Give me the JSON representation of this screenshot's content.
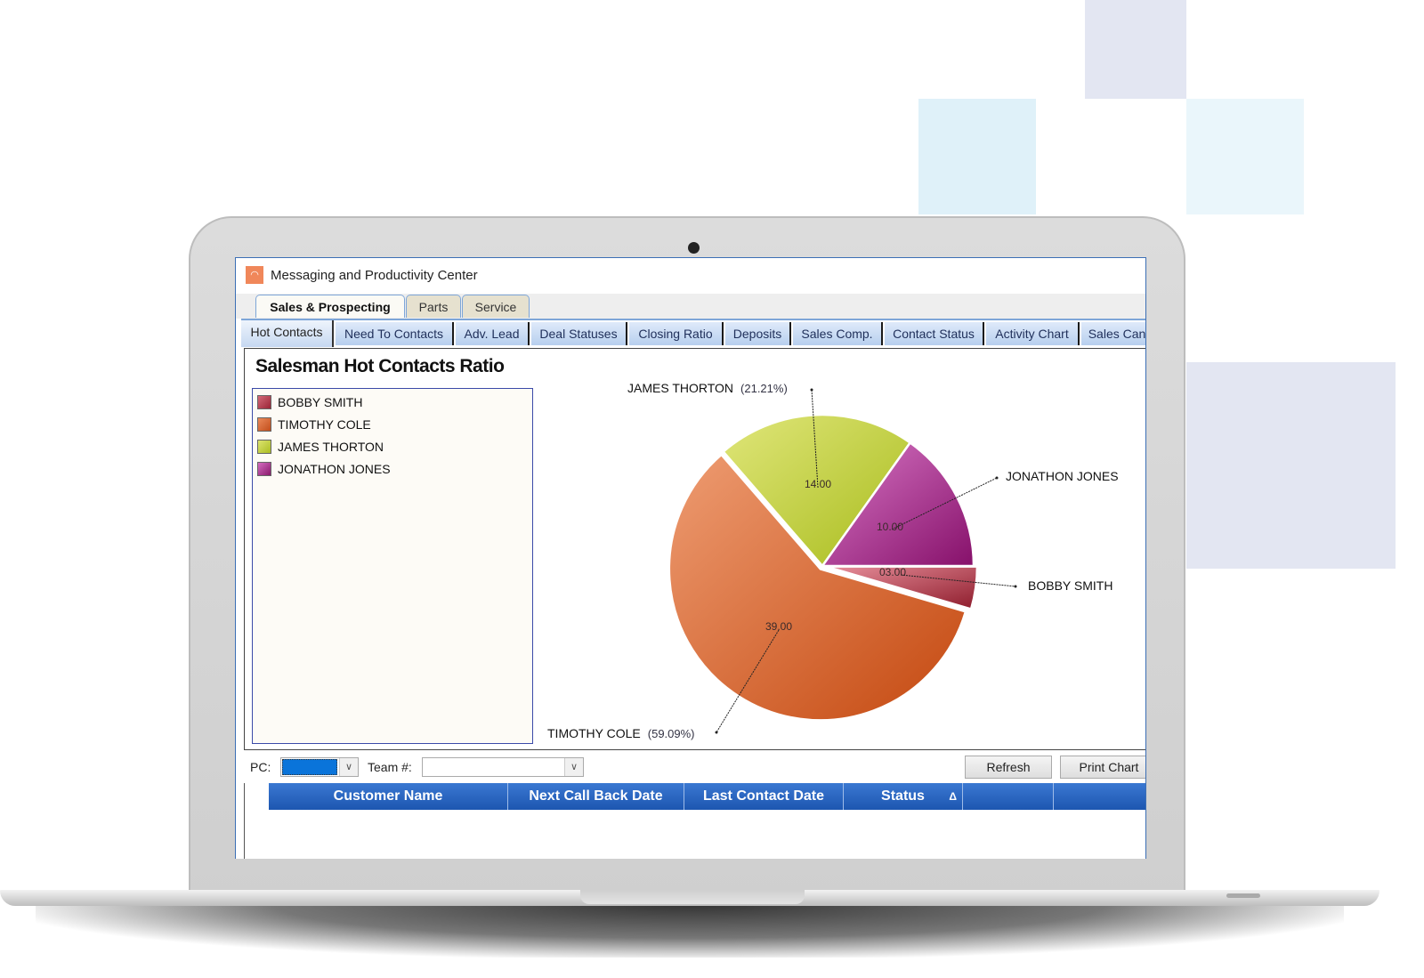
{
  "window": {
    "title": "Messaging and Productivity Center",
    "icon": "gauge-icon"
  },
  "main_tabs": [
    {
      "label": "Sales & Prospecting",
      "active": true
    },
    {
      "label": "Parts",
      "active": false
    },
    {
      "label": "Service",
      "active": false
    }
  ],
  "sub_tabs": [
    {
      "label": "Hot Contacts",
      "active": true
    },
    {
      "label": "Need To Contacts"
    },
    {
      "label": "Adv. Lead"
    },
    {
      "label": "Deal Statuses"
    },
    {
      "label": "Closing Ratio"
    },
    {
      "label": "Deposits"
    },
    {
      "label": "Sales Comp."
    },
    {
      "label": "Contact Status"
    },
    {
      "label": "Activity Chart"
    },
    {
      "label": "Sales Can"
    }
  ],
  "chart_data": {
    "type": "pie",
    "title": "Salesman Hot Contacts Ratio",
    "legend_placement": "left",
    "categories": [
      "BOBBY SMITH",
      "TIMOTHY COLE",
      "JAMES THORTON",
      "JONATHON JONES"
    ],
    "values": [
      3,
      39,
      14,
      10
    ],
    "value_labels": [
      "03.00",
      "39.00",
      "14.00",
      "10.00"
    ],
    "percent_labels": [
      "",
      "(59.09%)",
      "(21.21%)",
      ""
    ],
    "colors": [
      "#c0485a",
      "#d9622f",
      "#c4d43c",
      "#b0409a"
    ]
  },
  "filters": {
    "pc_label": "PC:",
    "pc_value_color": "#0a74da",
    "team_label": "Team #:",
    "team_value": ""
  },
  "buttons": {
    "refresh": "Refresh",
    "print_chart": "Print Chart"
  },
  "grid": {
    "columns": [
      "Customer Name",
      "Next Call Back Date",
      "Last Contact Date",
      "Status",
      "",
      ""
    ],
    "sort_indicator": "Δ"
  }
}
